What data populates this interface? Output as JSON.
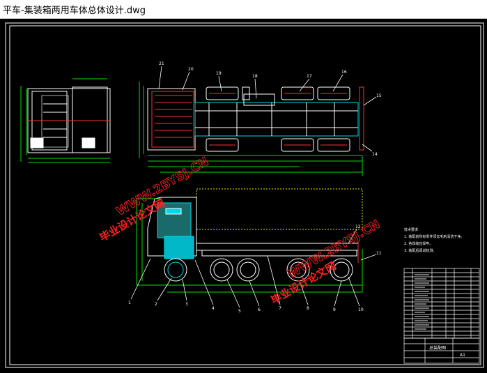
{
  "window": {
    "title": "平车-集装箱两用车体总体设计.dwg"
  },
  "watermark": {
    "cn": "毕业设计论文网",
    "url": "WWW.2BYSJ.CN"
  },
  "callouts": {
    "top": [
      "21",
      "20",
      "19",
      "18",
      "17",
      "16",
      "15",
      "14"
    ],
    "side": [
      "1",
      "2",
      "3",
      "4",
      "5",
      "6",
      "7",
      "8",
      "9",
      "10",
      "11",
      "12"
    ]
  },
  "notes": {
    "heading": "技术要求",
    "lines": [
      "1. 装配前所有零件须去毛刺清洗干净。",
      "2. 各焊缝应焊牢。",
      "3. 装配后调试检测。"
    ]
  },
  "title_block": {
    "name": "总装配图",
    "drawing_no": "A1"
  },
  "colors": {
    "bg": "#000000",
    "frame": "#ffffff",
    "line": "#ffffff",
    "cyan": "#00d8e8",
    "green": "#00e000",
    "red": "#ff3030",
    "yellow": "#e8e800",
    "watermark": "#ff2020"
  }
}
